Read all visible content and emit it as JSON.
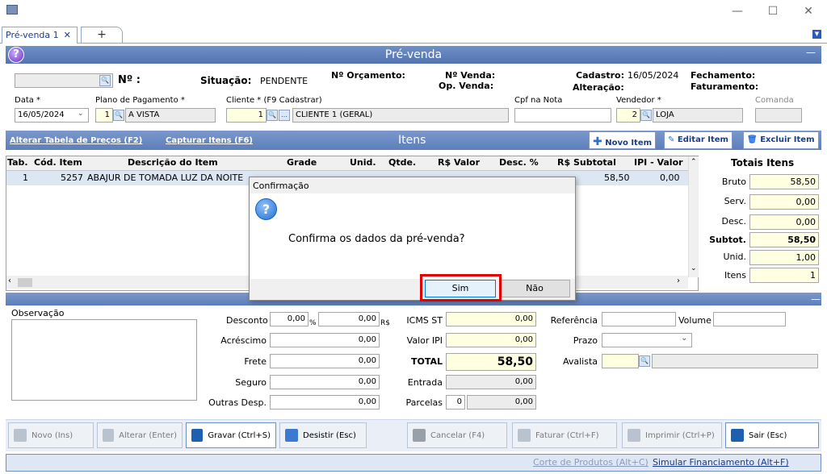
{
  "tab": {
    "label": "Pré-venda 1",
    "close": "✕",
    "add": "+"
  },
  "window": {
    "minimize": "—",
    "maximize": "☐",
    "close": "✕"
  },
  "header": {
    "title": "Pré-venda",
    "collapse": "—"
  },
  "form": {
    "numero_label": "Nº :",
    "situacao_label": "Situação:",
    "situacao_value": "PENDENTE",
    "orcamento_label": "Nº Orçamento:",
    "venda_label": "Nº Venda:",
    "op_venda_label": "Op. Venda:",
    "cadastro_label": "Cadastro:",
    "cadastro_value": "16/05/2024",
    "alteracao_label": "Alteração:",
    "fechamento_label": "Fechamento:",
    "faturamento_label": "Faturamento:",
    "data_label": "Data *",
    "data_value": "16/05/2024",
    "plano_label": "Plano de Pagamento *",
    "plano_code": "1",
    "plano_value": "A VISTA",
    "cliente_label": "Cliente * (F9 Cadastrar)",
    "cliente_code": "1",
    "cliente_value": "CLIENTE 1 (GERAL)",
    "cpf_label": "Cpf na Nota",
    "vendedor_label": "Vendedor *",
    "vendedor_code": "2",
    "vendedor_value": "LOJA",
    "comanda_label": "Comanda"
  },
  "itemsbar": {
    "alterar": "Alterar Tabela de Preços (F2)",
    "capturar": "Capturar Itens (F6)",
    "title": "Itens",
    "novo": "Novo Item",
    "editar": "Editar Item",
    "excluir": "Excluir Item"
  },
  "grid": {
    "headers": [
      "Tab.",
      "Cód. Item",
      "Descrição do Item",
      "Grade",
      "Unid.",
      "Qtde.",
      "R$ Valor",
      "Desc. %",
      "R$ Subtotal",
      "IPI - Valor"
    ],
    "rows": [
      {
        "tab": "1",
        "cod": "5257",
        "desc": "ABAJUR DE TOMADA  LUZ DA NOITE",
        "subtotal": "58,50",
        "ipi": "0,00"
      }
    ]
  },
  "totais": {
    "title": "Totais Itens",
    "bruto_label": "Bruto",
    "bruto": "58,50",
    "serv_label": "Serv.",
    "serv": "0,00",
    "desc_label": "Desc.",
    "desc": "0,00",
    "subtot_label": "Subtot.",
    "subtot": "58,50",
    "unid_label": "Unid.",
    "unid": "1,00",
    "itens_label": "Itens",
    "itens": "1"
  },
  "bottom": {
    "obs_label": "Observação",
    "desconto_label": "Desconto",
    "desconto_pct": "0,00",
    "pct_sign": "%",
    "desconto_val": "0,00",
    "rs": "R$",
    "acrescimo_label": "Acréscimo",
    "acrescimo": "0,00",
    "frete_label": "Frete",
    "frete": "0,00",
    "seguro_label": "Seguro",
    "seguro": "0,00",
    "outras_label": "Outras Desp.",
    "outras": "0,00",
    "icms_label": "ICMS ST",
    "icms": "0,00",
    "ipi_label": "Valor IPI",
    "ipi": "0,00",
    "total_label": "TOTAL",
    "total": "58,50",
    "entrada_label": "Entrada",
    "entrada": "0,00",
    "parcelas_label": "Parcelas",
    "parcelas_n": "0",
    "parcelas": "0,00",
    "referencia_label": "Referência",
    "volume_label": "Volume",
    "prazo_label": "Prazo",
    "avalista_label": "Avalista"
  },
  "footer": {
    "novo": "Novo (Ins)",
    "alterar": "Alterar (Enter)",
    "gravar": "Gravar (Ctrl+S)",
    "desistir": "Desistir (Esc)",
    "cancelar": "Cancelar (F4)",
    "faturar": "Faturar (Ctrl+F)",
    "imprimir": "Imprimir (Ctrl+P)",
    "sair": "Sair (Esc)"
  },
  "status": {
    "corte": "Corte de Produtos (Alt+C)",
    "simular": "Simular Financiamento (Alt+F)"
  },
  "dialog": {
    "title": "Confirmação",
    "message": "Confirma os dados da pré-venda?",
    "yes": "Sim",
    "no": "Não"
  }
}
